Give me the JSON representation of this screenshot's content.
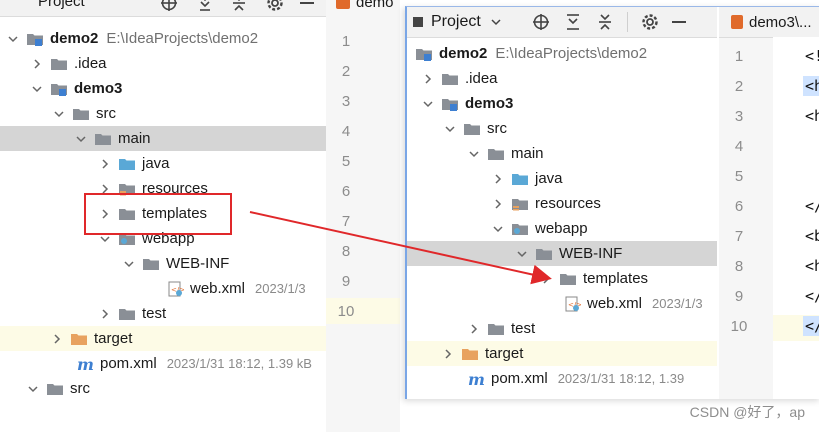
{
  "left_panel": {
    "header_title": "Project",
    "editor_tab": "demo",
    "tree": [
      {
        "label": "demo2",
        "path": "E:\\IdeaProjects\\demo2",
        "bold": true
      },
      {
        "label": ".idea"
      },
      {
        "label": "demo3",
        "bold": true
      },
      {
        "label": "src"
      },
      {
        "label": "main"
      },
      {
        "label": "java"
      },
      {
        "label": "resources"
      },
      {
        "label": "templates"
      },
      {
        "label": "webapp"
      },
      {
        "label": "WEB-INF"
      },
      {
        "label": "web.xml",
        "meta": "2023/1/3"
      },
      {
        "label": "test"
      },
      {
        "label": "target"
      },
      {
        "label": "pom.xml",
        "meta": "2023/1/31 18:12, 1.39 kB"
      },
      {
        "label": "src"
      }
    ],
    "line_numbers": [
      "1",
      "2",
      "3",
      "4",
      "5",
      "6",
      "7",
      "8",
      "9",
      "10"
    ]
  },
  "right_panel": {
    "header_title": "Project",
    "editor_tab": "demo3\\...",
    "tree": [
      {
        "label": "demo2",
        "path": "E:\\IdeaProjects\\demo2",
        "bold": true
      },
      {
        "label": ".idea"
      },
      {
        "label": "demo3",
        "bold": true
      },
      {
        "label": "src"
      },
      {
        "label": "main"
      },
      {
        "label": "java"
      },
      {
        "label": "resources"
      },
      {
        "label": "webapp"
      },
      {
        "label": "WEB-INF"
      },
      {
        "label": "templates"
      },
      {
        "label": "web.xml",
        "meta": "2023/1/3"
      },
      {
        "label": "test"
      },
      {
        "label": "target"
      },
      {
        "label": "pom.xml",
        "meta": "2023/1/31 18:12, 1.39"
      }
    ],
    "line_numbers": [
      "1",
      "2",
      "3",
      "4",
      "5",
      "6",
      "7",
      "8",
      "9",
      "10"
    ],
    "code_fragments": [
      "<!",
      "<h",
      "<h",
      "</",
      "<b",
      "<h",
      "</",
      "</"
    ]
  },
  "watermark": "CSDN @好了，ap",
  "colors": {
    "folder": "#8a8f96",
    "source_folder": "#5aa8d6",
    "target_folder": "#e8a25f",
    "module_square": "#3d7fd1",
    "annotation_red": "#e0282a",
    "selection": "#d5d5d5"
  }
}
